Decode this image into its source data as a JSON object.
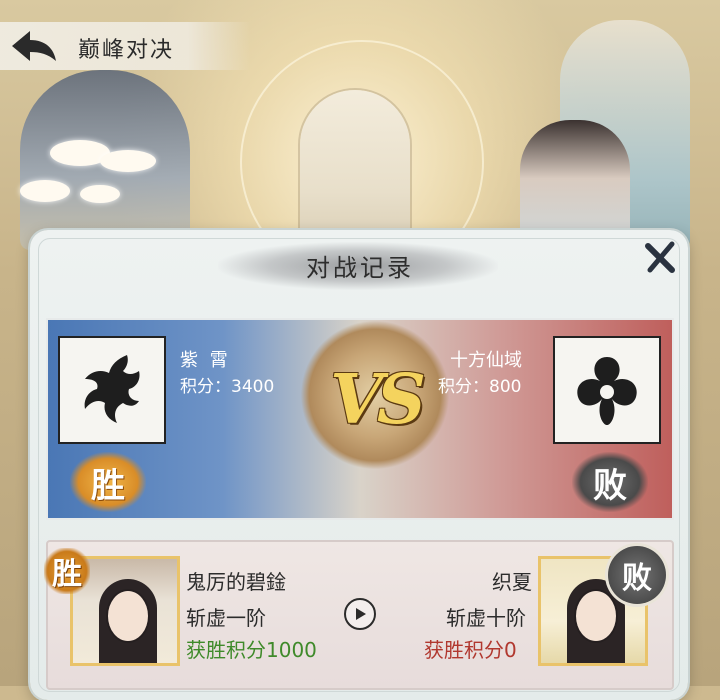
{
  "header": {
    "title": "巅峰对决"
  },
  "modal": {
    "title": "对战记录"
  },
  "left_player": {
    "name": "紫 霄",
    "score_label": "积分：",
    "score": "3400",
    "result": "胜",
    "emblem": "dragon-emblem"
  },
  "right_player": {
    "name": "十方仙域",
    "score_label": "积分：",
    "score": "800",
    "result": "败",
    "emblem": "trefoil-emblem"
  },
  "vs_label": "VS",
  "record": {
    "left": {
      "result": "胜",
      "name": "鬼厉的碧鍂",
      "rank": "斩虚一阶",
      "score_text": "获胜积分1000"
    },
    "right": {
      "result": "败",
      "name": "织夏",
      "rank": "斩虚十阶",
      "score_text": "获胜积分0"
    },
    "play_icon": "play-icon"
  },
  "colors": {
    "left_team": "#4a77b5",
    "right_team": "#bf5f5c",
    "win_score": "#3f8a2a",
    "lose_score": "#b1382f",
    "win_seal": "#d98d28",
    "lose_seal": "#4a4a4a"
  }
}
